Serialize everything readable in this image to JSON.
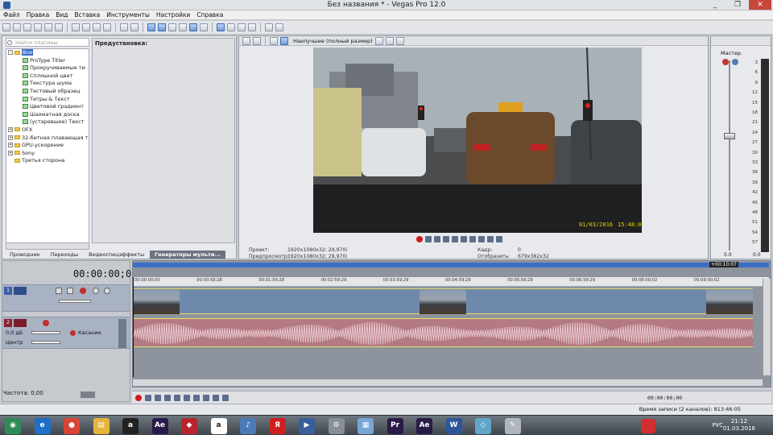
{
  "window": {
    "title": "Без названия * - Vegas Pro 12.0",
    "minimize": "_",
    "maximize": "❐",
    "close": "✕"
  },
  "menu": [
    "Файл",
    "Правка",
    "Вид",
    "Вставка",
    "Инструменты",
    "Настройки",
    "Справка"
  ],
  "explorer": {
    "search_placeholder": "Найти плагины",
    "preset_header": "Предустановка:",
    "tree": [
      {
        "label": "Все",
        "kind": "folder",
        "selected": true,
        "expand": "-"
      },
      {
        "label": "ProType Titler",
        "kind": "gen"
      },
      {
        "label": "Прокручиваемые ти",
        "kind": "gen"
      },
      {
        "label": "Сплошной цвет",
        "kind": "gen"
      },
      {
        "label": "Текстура шума",
        "kind": "gen"
      },
      {
        "label": "Тестовый образец",
        "kind": "gen"
      },
      {
        "label": "Титры & Текст",
        "kind": "gen"
      },
      {
        "label": "Цветовой градиент",
        "kind": "gen"
      },
      {
        "label": "Шахматная доска",
        "kind": "gen"
      },
      {
        "label": "(устаревшее) Текст",
        "kind": "gen"
      },
      {
        "label": "OFX",
        "kind": "folder",
        "expand": "+"
      },
      {
        "label": "32-битная плавающая т",
        "kind": "folder",
        "expand": "+"
      },
      {
        "label": "GPU-ускорение",
        "kind": "folder",
        "expand": "+"
      },
      {
        "label": "Sony",
        "kind": "folder",
        "expand": "+"
      },
      {
        "label": "Третья сторона",
        "kind": "folder"
      }
    ],
    "tabs": [
      {
        "label": "Проводник",
        "active": false
      },
      {
        "label": "Переходы",
        "active": false
      },
      {
        "label": "Видеоспецэффекты",
        "active": false
      },
      {
        "label": "Генераторы мульти...",
        "active": true
      }
    ]
  },
  "preview": {
    "quality": "Наилучшее (полный размер)",
    "overlay_date": "01/03/2016",
    "overlay_time": "15:48:0",
    "info": {
      "project_label": "Проект:",
      "project_value": "1920x1080x32; 29,970i",
      "preview_label": "Предпросмотр:",
      "preview_value": "1920x1080x32; 29,970i",
      "frame_label": "Кадр:",
      "frame_value": "0",
      "display_label": "Отобразить:",
      "display_value": "679x382x32"
    }
  },
  "mixer": {
    "label": "Мастер",
    "scale": [
      "3",
      "6",
      "9",
      "12",
      "15",
      "18",
      "21",
      "24",
      "27",
      "30",
      "33",
      "36",
      "39",
      "42",
      "45",
      "48",
      "51",
      "54",
      "57"
    ],
    "bottom_left": "0.0",
    "bottom_right": "0.0"
  },
  "tracks": {
    "timecode": "00:00:00;00",
    "video_num": "1",
    "audio_num": "2",
    "audio_db": "0,0 дБ",
    "audio_pan": "Центр",
    "audio_mode": "Касание"
  },
  "ruler": {
    "marker": "+00:10:07",
    "ticks": [
      "00:00:00;00",
      "00:00:59;28",
      "00:01:59;28",
      "00:02:59;29",
      "00:03:59;29",
      "00:04:59;29",
      "00:05:59;29",
      "00:06:59;29",
      "00:08:00;02",
      "00:09:00;02"
    ]
  },
  "transport": {
    "rate": "Частота: 0,00",
    "time": "00:00:00;00"
  },
  "status": {
    "rec_time": "Время записи (2 каналов): 813:46:05"
  },
  "taskbar": {
    "lang": "РУС",
    "time": "21:12",
    "date": "01.03.2016",
    "apps": [
      {
        "name": "start",
        "color": "#2e8b57",
        "glyph": "◉"
      },
      {
        "name": "ie",
        "color": "#1e6fc8",
        "glyph": "e"
      },
      {
        "name": "chrome",
        "color": "#d94436",
        "glyph": "●"
      },
      {
        "name": "explorer",
        "color": "#e6b63c",
        "glyph": "▤"
      },
      {
        "name": "app-a",
        "color": "#222222",
        "glyph": "a"
      },
      {
        "name": "after-effects",
        "color": "#2a1a4a",
        "glyph": "Ae"
      },
      {
        "name": "vegas-red",
        "color": "#b8242c",
        "glyph": "◆"
      },
      {
        "name": "amazon",
        "color": "#ffffff",
        "glyph": "a"
      },
      {
        "name": "audio",
        "color": "#4a7ab8",
        "glyph": "♪"
      },
      {
        "name": "yandex",
        "color": "#d01f1f",
        "glyph": "Я"
      },
      {
        "name": "vegas-pro",
        "color": "#3a5f9a",
        "glyph": "▶"
      },
      {
        "name": "settings",
        "color": "#8a8f96",
        "glyph": "⚙"
      },
      {
        "name": "notepad",
        "color": "#7aa6d6",
        "glyph": "▦"
      },
      {
        "name": "premiere",
        "color": "#2a1a4a",
        "glyph": "Pr"
      },
      {
        "name": "after-effects-2",
        "color": "#2a1a4a",
        "glyph": "Ae"
      },
      {
        "name": "word",
        "color": "#2b579a",
        "glyph": "W"
      },
      {
        "name": "tool",
        "color": "#5fa6c8",
        "glyph": "◇"
      },
      {
        "name": "paint",
        "color": "#b0b6bc",
        "glyph": "✎"
      }
    ]
  },
  "colors": {
    "accent": "#3b6fc7",
    "video_track": "#6f89ad",
    "audio_track": "#b37a85",
    "selection_border": "#e8e066"
  }
}
